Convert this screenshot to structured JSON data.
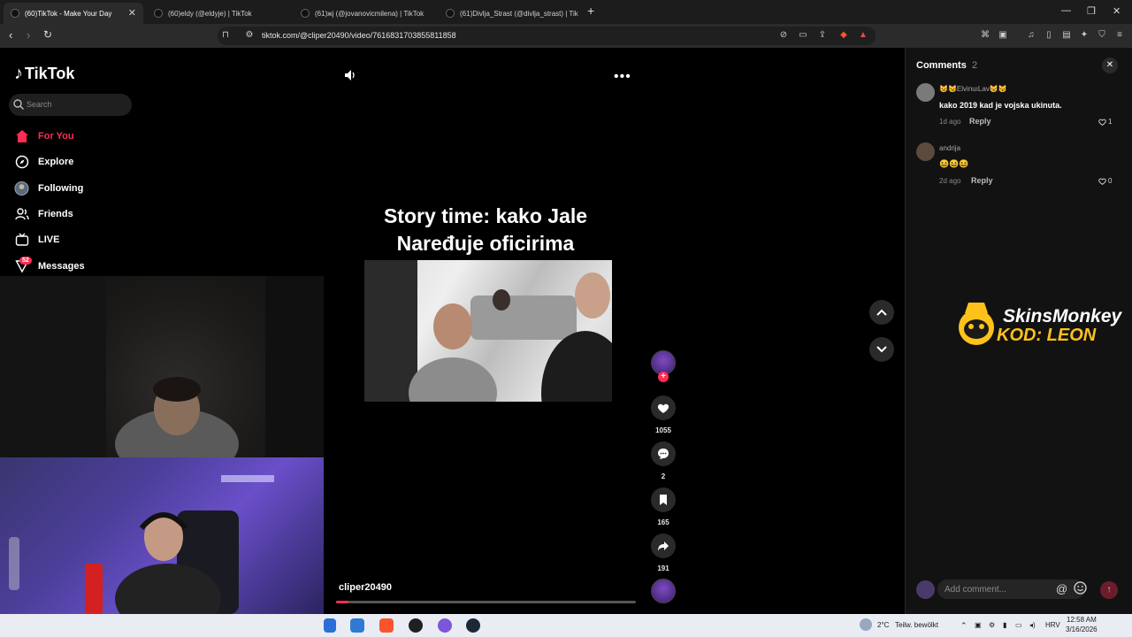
{
  "browser": {
    "tabs": [
      {
        "label": "(60)TikTok - Make Your Day",
        "active": true
      },
      {
        "label": "(60)eldy (@eldyje) | TikTok",
        "active": false
      },
      {
        "label": "(61)жj (@jovanovicmilena) | TikTok",
        "active": false
      },
      {
        "label": "(61)Divlja_Strast (@divlja_strast) | Tik",
        "active": false
      }
    ],
    "url": "tiktok.com/@cliper20490/video/7616831703855811858"
  },
  "sidebar": {
    "logo_text": "TikTok",
    "search_placeholder": "Search",
    "nav": [
      {
        "label": "For You",
        "icon": "home-icon",
        "active": true
      },
      {
        "label": "Explore",
        "icon": "compass-icon",
        "active": false
      },
      {
        "label": "Following",
        "icon": "following-avatar-icon",
        "active": false
      },
      {
        "label": "Friends",
        "icon": "friends-icon",
        "active": false
      },
      {
        "label": "LIVE",
        "icon": "live-tv-icon",
        "active": false
      },
      {
        "label": "Messages",
        "icon": "messages-icon",
        "active": false
      }
    ],
    "messages_badge": "52"
  },
  "video": {
    "caption_line1": "Story time: kako Jale",
    "caption_line2": "Naređuje oficirima",
    "author": "cliper20490",
    "progress_fraction": 0.04,
    "likes": "1055",
    "comments": "2",
    "saves": "165",
    "shares": "191"
  },
  "comments": {
    "title": "Comments",
    "count": "2",
    "items": [
      {
        "user": "😼😼ElvinuıLav😼😼",
        "text": "kako 2019 kad je vojska ukinuta.",
        "time": "1d ago",
        "reply": "Reply",
        "likes": "1"
      },
      {
        "user": "andrija",
        "text": "😆😆😆",
        "time": "2d ago",
        "reply": "Reply",
        "likes": "0"
      }
    ],
    "add_placeholder": "Add comment...",
    "at_symbol": "@"
  },
  "sponsor": {
    "line1": "SkinsMonkey",
    "line2": "KOD: LEON"
  },
  "taskbar": {
    "weather_temp": "2°C",
    "weather_desc": "Teilw. bewölkt",
    "language": "HRV",
    "time": "12:58 AM",
    "date": "3/16/2026"
  },
  "colors": {
    "accent": "#fe2c55",
    "sponsor_yellow": "#ffc21a",
    "panel": "#121212"
  }
}
